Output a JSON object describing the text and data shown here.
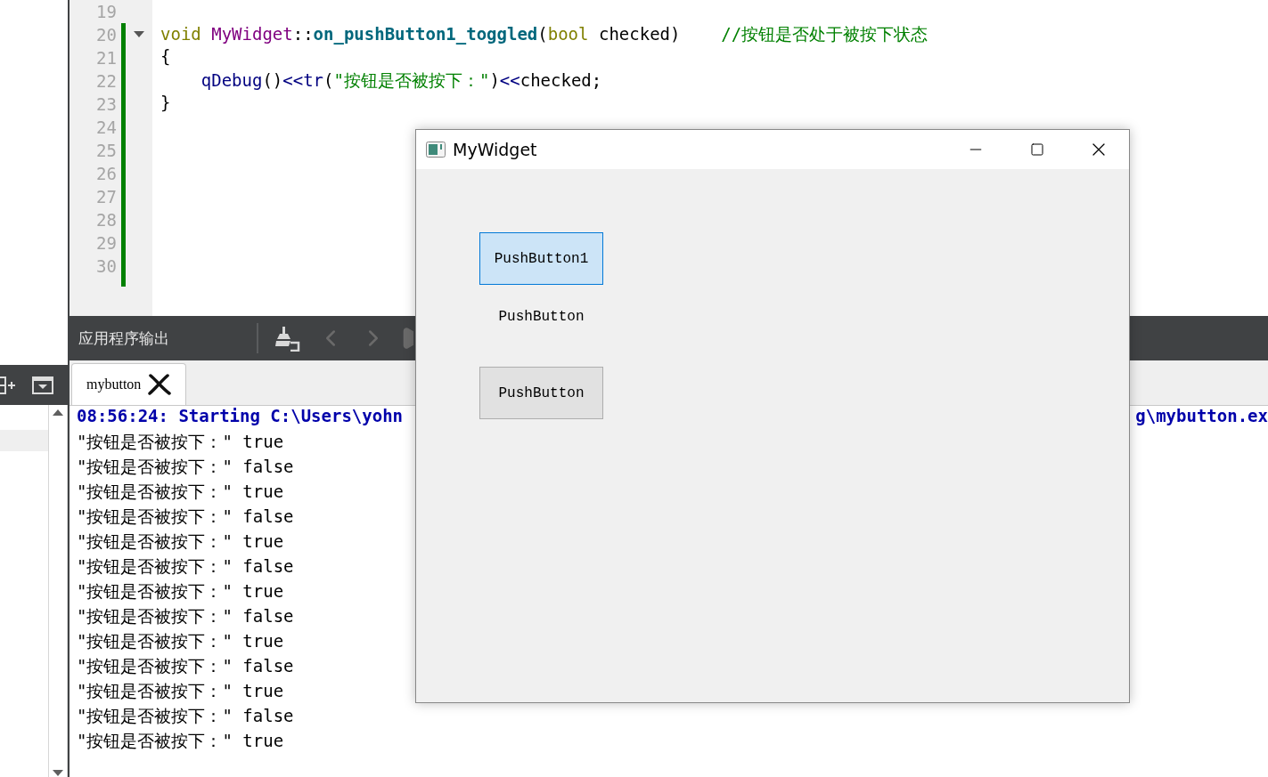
{
  "editor": {
    "lines": [
      {
        "number": "19"
      },
      {
        "number": "20",
        "folded": false,
        "tokens": [
          {
            "kind": "keyword",
            "text": "void "
          },
          {
            "kind": "type",
            "text": "MyWidget"
          },
          {
            "kind": "plain",
            "text": "::"
          },
          {
            "kind": "function",
            "text": "on_pushButton1_toggled"
          },
          {
            "kind": "plain",
            "text": "("
          },
          {
            "kind": "keyword",
            "text": "bool"
          },
          {
            "kind": "plain",
            "text": " checked)    "
          },
          {
            "kind": "comment",
            "text": "//按钮是否处于被按下状态"
          }
        ]
      },
      {
        "number": "21",
        "tokens": [
          {
            "kind": "plain",
            "text": "{"
          }
        ]
      },
      {
        "number": "22",
        "indented": true,
        "tokens": [
          {
            "kind": "call",
            "text": "qDebug"
          },
          {
            "kind": "plain",
            "text": "()"
          },
          {
            "kind": "operator",
            "text": "<<tr"
          },
          {
            "kind": "plain",
            "text": "("
          },
          {
            "kind": "string",
            "text": "\"按钮是否被按下：\""
          },
          {
            "kind": "plain",
            "text": ")"
          },
          {
            "kind": "operator",
            "text": "<<"
          },
          {
            "kind": "plain",
            "text": "checked;"
          }
        ]
      },
      {
        "number": "23",
        "tokens": [
          {
            "kind": "plain",
            "text": "}"
          }
        ]
      },
      {
        "number": "24"
      },
      {
        "number": "25"
      },
      {
        "number": "26"
      },
      {
        "number": "27"
      },
      {
        "number": "28"
      },
      {
        "number": "29"
      },
      {
        "number": "30"
      }
    ]
  },
  "side_list": {
    "items": [
      {
        "selected": true
      }
    ]
  },
  "output": {
    "title": "应用程序输出",
    "tabs": [
      {
        "label": "mybutton",
        "selected": true
      }
    ],
    "lines": [
      {
        "kind": "status",
        "text": "08:56:24: Starting C:\\Users\\yohn",
        "tail": "g\\mybutton.ex"
      },
      {
        "kind": "plain",
        "text": "\"按钮是否被按下：\" true"
      },
      {
        "kind": "plain",
        "text": "\"按钮是否被按下：\" false"
      },
      {
        "kind": "plain",
        "text": "\"按钮是否被按下：\" true"
      },
      {
        "kind": "plain",
        "text": "\"按钮是否被按下：\" false"
      },
      {
        "kind": "plain",
        "text": "\"按钮是否被按下：\" true"
      },
      {
        "kind": "plain",
        "text": "\"按钮是否被按下：\" false"
      },
      {
        "kind": "plain",
        "text": "\"按钮是否被按下：\" true"
      },
      {
        "kind": "plain",
        "text": "\"按钮是否被按下：\" false"
      },
      {
        "kind": "plain",
        "text": "\"按钮是否被按下：\" true"
      },
      {
        "kind": "plain",
        "text": "\"按钮是否被按下：\" false"
      },
      {
        "kind": "plain",
        "text": "\"按钮是否被按下：\" true"
      },
      {
        "kind": "plain",
        "text": "\"按钮是否被按下：\" false"
      },
      {
        "kind": "plain",
        "text": "\"按钮是否被按下：\" true"
      }
    ]
  },
  "window": {
    "title": "MyWidget",
    "widgets": [
      {
        "kind": "button",
        "label": "PushButton1",
        "checked": true
      },
      {
        "kind": "label",
        "text": "PushButton"
      },
      {
        "kind": "button",
        "label": "PushButton",
        "checked": false
      }
    ]
  }
}
